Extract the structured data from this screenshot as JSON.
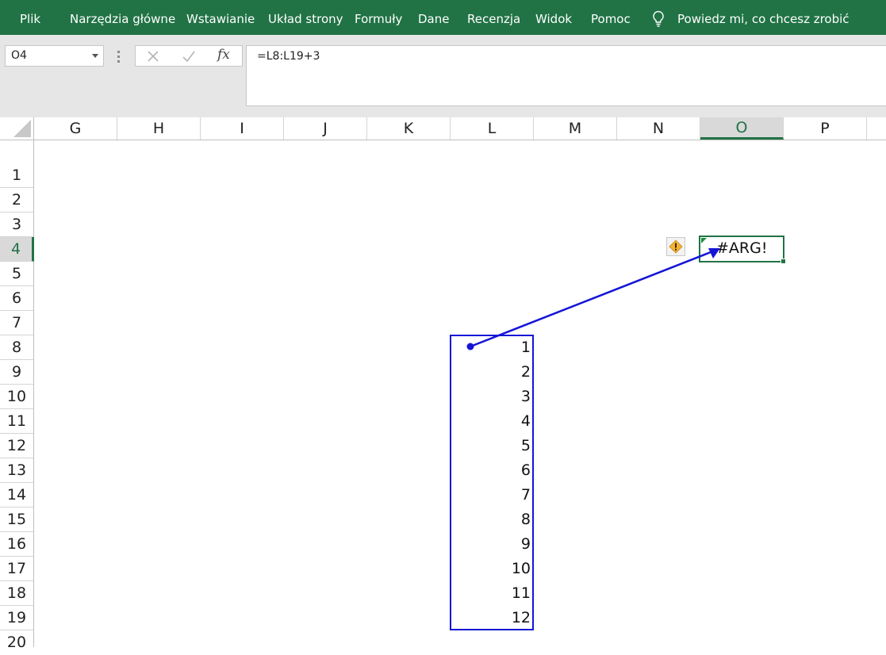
{
  "ribbon": {
    "tabs": [
      "Plik",
      "Narzędzia główne",
      "Wstawianie",
      "Układ strony",
      "Formuły",
      "Dane",
      "Recenzja",
      "Widok",
      "Pomoc"
    ],
    "tell_me": "Powiedz mi, co chcesz zrobić",
    "tell_me_icon": "lightbulb-icon",
    "accent_color": "#217346"
  },
  "formula_bar": {
    "name_box": "O4",
    "formula": "=L8:L19+3",
    "fx_label": "fx"
  },
  "grid": {
    "columns": [
      "G",
      "H",
      "I",
      "J",
      "K",
      "L",
      "M",
      "N",
      "O",
      "P"
    ],
    "selected_column": "O",
    "rows": [
      "1",
      "2",
      "3",
      "4",
      "5",
      "6",
      "7",
      "8",
      "9",
      "10",
      "11",
      "12",
      "13",
      "14",
      "15",
      "16",
      "17",
      "18",
      "19",
      "20"
    ],
    "selected_row": "4"
  },
  "cells": {
    "L_values": [
      "1",
      "2",
      "3",
      "4",
      "5",
      "6",
      "7",
      "8",
      "9",
      "10",
      "11",
      "12"
    ],
    "O4": "#ARG!"
  },
  "tracer_color": "#1515d6"
}
